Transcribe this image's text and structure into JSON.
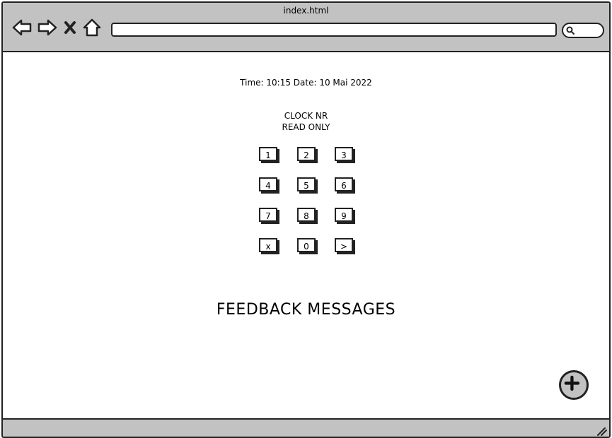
{
  "browser": {
    "tab_title": "index.html",
    "address_value": "",
    "search_value": "",
    "icons": {
      "back": "arrow-left-icon",
      "forward": "arrow-right-icon",
      "stop": "close-icon",
      "home": "home-icon",
      "search": "search-icon",
      "resize": "resize-grip-icon"
    }
  },
  "page": {
    "datetime": "Time: 10:15 Date: 10 Mai 2022",
    "clock_label_line1": "CLOCK NR",
    "clock_label_line2": "READ ONLY",
    "keypad": {
      "keys": [
        "1",
        "2",
        "3",
        "4",
        "5",
        "6",
        "7",
        "8",
        "9",
        "x",
        "0",
        ">"
      ]
    },
    "feedback": "FEEDBACK MESSAGES",
    "fab_icon": "plus-icon"
  },
  "colors": {
    "chrome": "#c2c2c2",
    "border": "#222222",
    "background": "#ffffff"
  }
}
